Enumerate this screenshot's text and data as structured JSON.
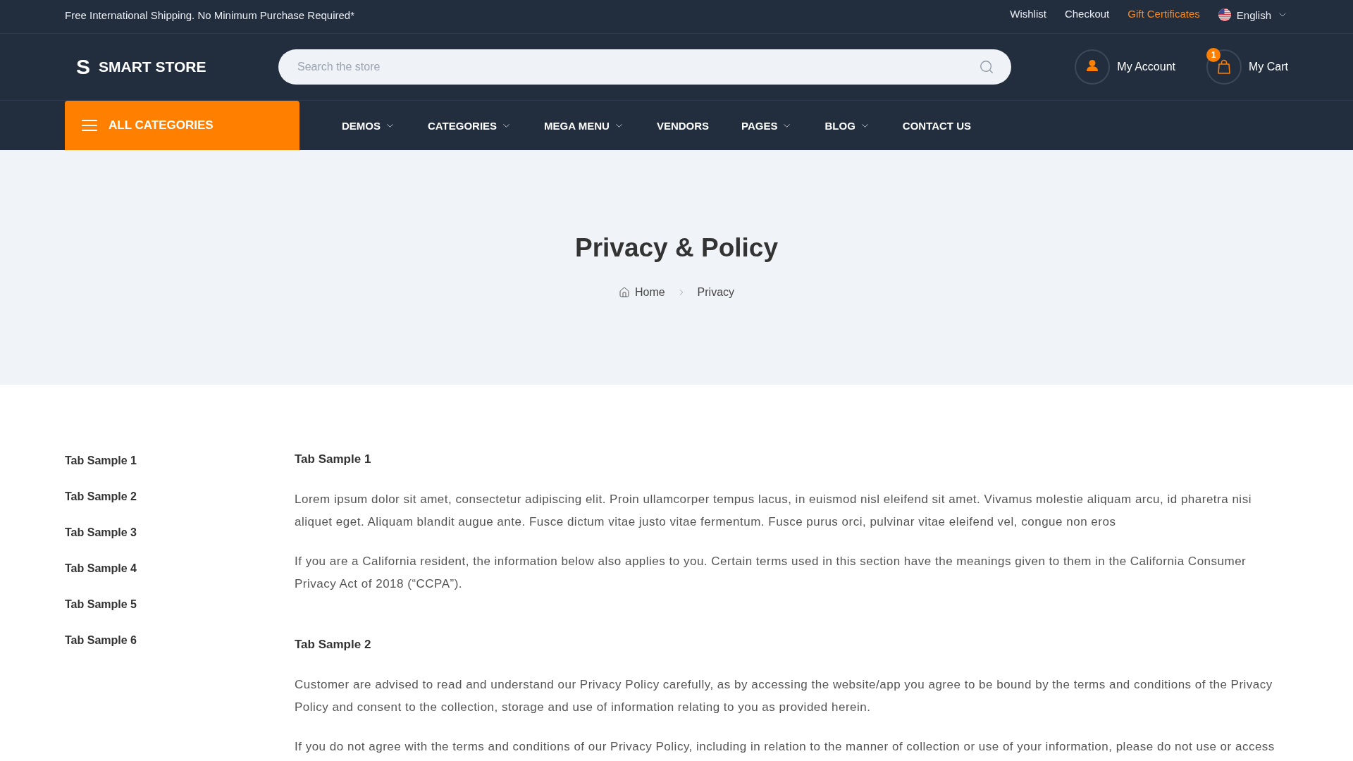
{
  "top_bar": {
    "promo": "Free International Shipping. No Minimum Purchase Required*",
    "links": [
      {
        "label": "Wishlist",
        "highlighted": false
      },
      {
        "label": "Checkout",
        "highlighted": false
      },
      {
        "label": "Gift Certificates",
        "highlighted": true
      }
    ],
    "language": {
      "label": "English"
    }
  },
  "header": {
    "logo": {
      "mark": "S",
      "name": "SMART STORE"
    },
    "search": {
      "placeholder": "Search the store"
    },
    "account": {
      "label": "My Account"
    },
    "cart": {
      "label": "My Cart",
      "count": "1"
    }
  },
  "nav": {
    "all_categories": {
      "label": "ALL CATEGORIES"
    },
    "items": [
      {
        "label": "DEMOS",
        "dropdown": true
      },
      {
        "label": "CATEGORIES",
        "dropdown": true
      },
      {
        "label": "MEGA MENU",
        "dropdown": true
      },
      {
        "label": "VENDORS",
        "dropdown": false
      },
      {
        "label": "PAGES",
        "dropdown": true
      },
      {
        "label": "BLOG",
        "dropdown": true
      },
      {
        "label": "CONTACT US",
        "dropdown": false
      }
    ]
  },
  "hero": {
    "title": "Privacy & Policy",
    "breadcrumb": [
      {
        "label": "Home",
        "kind": "home"
      },
      {
        "label": "Privacy",
        "kind": "current"
      }
    ]
  },
  "tab_list": [
    "Tab Sample 1",
    "Tab Sample 2",
    "Tab Sample 3",
    "Tab Sample 4",
    "Tab Sample 5",
    "Tab Sample 6"
  ],
  "sections": [
    {
      "heading": "Tab Sample 1",
      "paragraphs": [
        "Lorem ipsum dolor sit amet, consectetur adipiscing elit. Proin ullamcorper tempus lacus, in euismod nisl eleifend sit amet. Vivamus molestie aliquam arcu, id pharetra nisi aliquet eget. Aliquam blandit augue ante. Fusce dictum vitae justo vitae fermentum. Fusce purus orci, pulvinar vitae eleifend vel, congue non eros",
        "If you are a California resident, the information below also applies to you. Certain terms used in this section have the meanings given to them in the California Consumer Privacy Act of 2018 (“CCPA”)."
      ]
    },
    {
      "heading": "Tab Sample 2",
      "paragraphs": [
        "Customer are advised to read and understand our Privacy Policy carefully, as by accessing the website/app you agree to be bound by the terms and conditions of the Privacy Policy and consent to the collection, storage and use of information relating to you as provided herein.",
        "If you do not agree with the terms and conditions of our Privacy Policy, including in relation to the manner of collection or use of your information, please do not use or access"
      ]
    }
  ]
}
